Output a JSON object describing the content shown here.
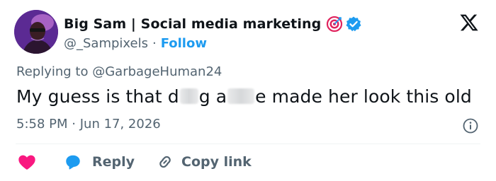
{
  "author": {
    "display_name": "Big Sam | Social media marketing",
    "handle": "@_Sampixels",
    "separator": "·",
    "follow_label": "Follow",
    "badges": [
      "target-emoji-icon",
      "verified-badge-icon"
    ]
  },
  "brand": {
    "logo": "x-logo-icon"
  },
  "tweet": {
    "reply_prefix": "Replying to",
    "reply_handle": "@GarbageHuman24",
    "text_part1": "My guess is that d",
    "text_part2": "g a",
    "text_part3": "e made her look this old",
    "time": "5:58 PM",
    "date": "Jun 17, 2026",
    "meta_separator": "·"
  },
  "actions": {
    "reply_label": "Reply",
    "copy_label": "Copy link"
  },
  "colors": {
    "accent": "#1d9bf0",
    "like": "#f91880",
    "text": "#0f1419",
    "muted": "#536471",
    "divider": "#eff3f4"
  }
}
